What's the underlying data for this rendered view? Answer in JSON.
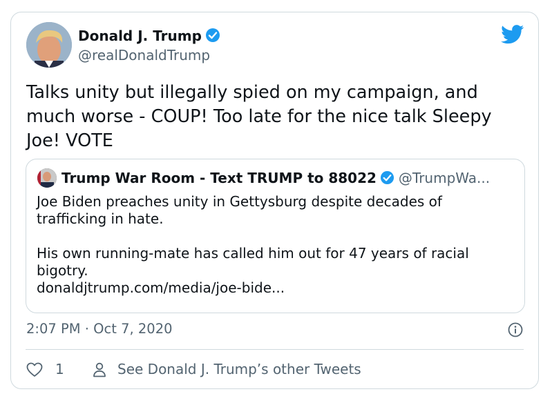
{
  "tweet": {
    "author_name": "Donald J. Trump",
    "author_handle": "@realDonaldTrump",
    "text_lines": [
      "Talks unity but illegally spied on my campaign, and",
      "much worse - COUP! Too late for the nice talk Sleepy",
      "Joe! VOTE"
    ],
    "timestamp": "2:07 PM · Oct 7, 2020",
    "like_count": "1",
    "other_tweets_label": "See Donald J. Trump’s other Tweets"
  },
  "quote": {
    "author_name": "Trump War Room - Text TRUMP to 88022",
    "author_handle": "@TrumpWa...",
    "lines": [
      "Joe Biden preaches unity in Gettysburg despite decades of",
      "trafficking in hate.",
      "His own running-mate has called him out for 47 years of racial",
      "bigotry.",
      "donaldjtrump.com/media/joe-bide..."
    ]
  },
  "icons": {
    "verified": "verified-badge-icon",
    "brand": "twitter-bird-icon",
    "info": "info-icon",
    "like": "heart-icon",
    "profile": "person-icon"
  },
  "colors": {
    "brand": "#1d9bf0",
    "text": "#0f1419",
    "secondary": "#536471",
    "border": "#cfd9de"
  }
}
